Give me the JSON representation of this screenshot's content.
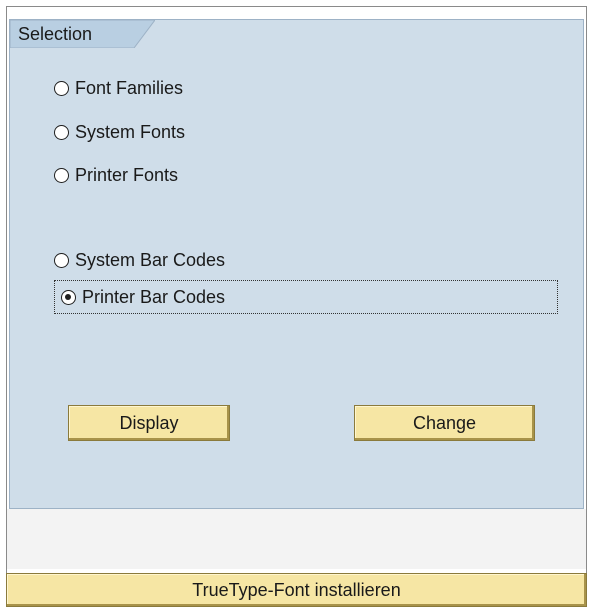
{
  "selection": {
    "title": "Selection",
    "options": [
      {
        "label": "Font Families",
        "checked": false
      },
      {
        "label": "System Fonts",
        "checked": false
      },
      {
        "label": "Printer Fonts",
        "checked": false
      },
      {
        "label": "System Bar Codes",
        "checked": false
      },
      {
        "label": "Printer Bar Codes",
        "checked": true
      }
    ]
  },
  "buttons": {
    "display": "Display",
    "change": "Change",
    "install_truetype": "TrueType-Font installieren"
  },
  "colors": {
    "panel_bg": "#cfdde9",
    "button_bg": "#f6e6a4"
  }
}
